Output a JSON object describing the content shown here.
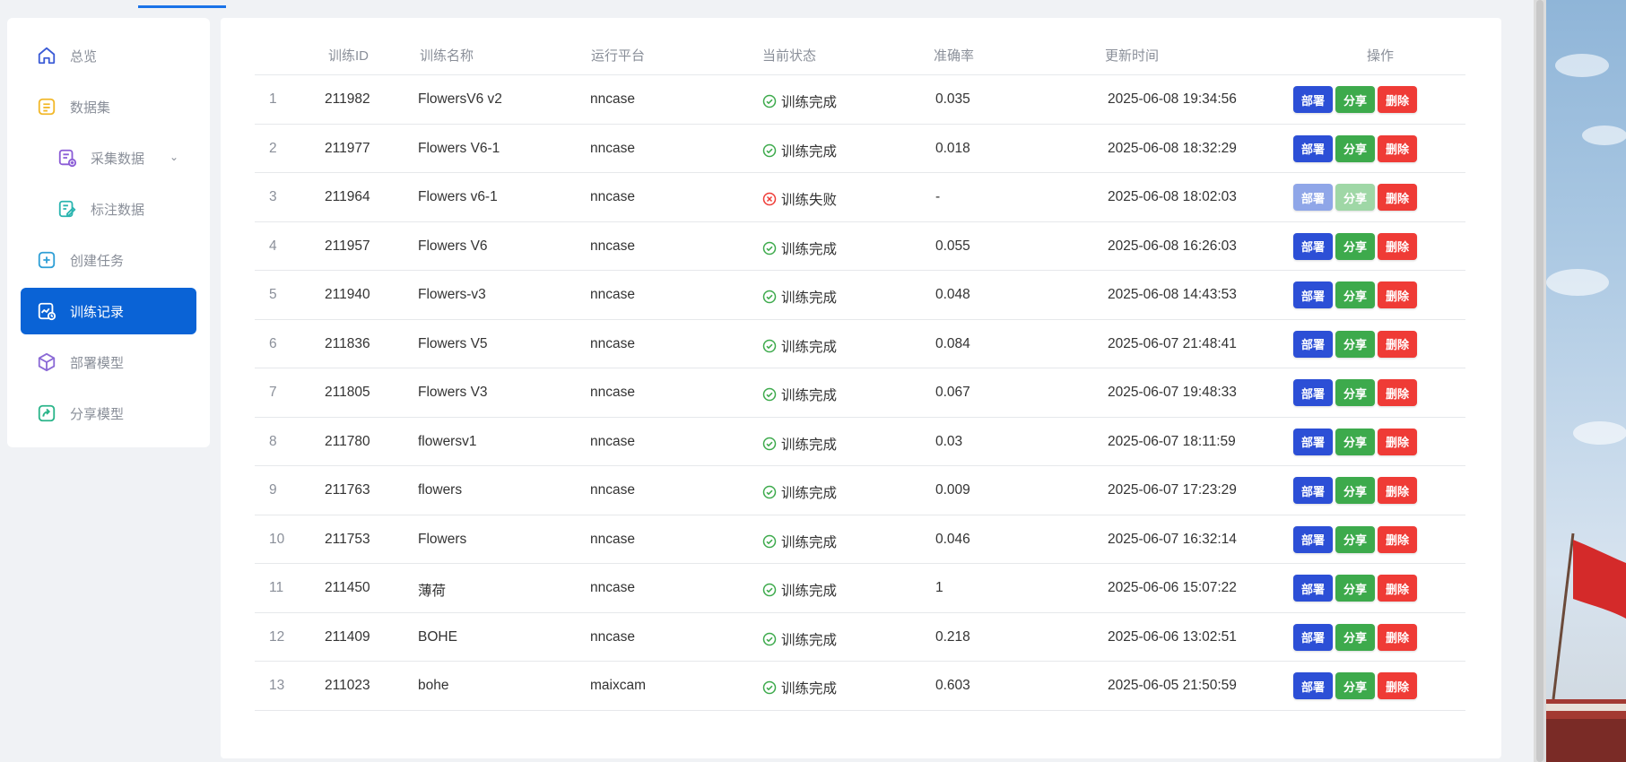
{
  "sidebar": {
    "items": [
      {
        "label": "总览",
        "icon": "home-icon"
      },
      {
        "label": "数据集",
        "icon": "dataset-icon"
      },
      {
        "label": "采集数据",
        "icon": "collect-data-icon"
      },
      {
        "label": "标注数据",
        "icon": "annotate-data-icon"
      },
      {
        "label": "创建任务",
        "icon": "plus-square-icon"
      },
      {
        "label": "训练记录",
        "icon": "training-record-icon"
      },
      {
        "label": "部署模型",
        "icon": "cube-icon"
      },
      {
        "label": "分享模型",
        "icon": "share-icon"
      }
    ],
    "active_index": 5,
    "chevron": "⌄"
  },
  "table": {
    "headers": {
      "id": "训练ID",
      "name": "训练名称",
      "platform": "运行平台",
      "status": "当前状态",
      "accuracy": "准确率",
      "updated": "更新时间",
      "actions": "操作"
    },
    "buttons": {
      "deploy": "部署",
      "share": "分享",
      "delete": "删除"
    },
    "rows": [
      {
        "no": "1",
        "id": "211982",
        "name": "FlowersV6 v2",
        "platform": "nncase",
        "status": "训练完成",
        "ok": true,
        "accuracy": "0.035",
        "updated": "2025-06-08 19:34:56"
      },
      {
        "no": "2",
        "id": "211977",
        "name": "Flowers V6-1",
        "platform": "nncase",
        "status": "训练完成",
        "ok": true,
        "accuracy": "0.018",
        "updated": "2025-06-08 18:32:29"
      },
      {
        "no": "3",
        "id": "211964",
        "name": "Flowers v6-1",
        "platform": "nncase",
        "status": "训练失败",
        "ok": false,
        "accuracy": "-",
        "updated": "2025-06-08 18:02:03"
      },
      {
        "no": "4",
        "id": "211957",
        "name": "Flowers V6",
        "platform": "nncase",
        "status": "训练完成",
        "ok": true,
        "accuracy": "0.055",
        "updated": "2025-06-08 16:26:03"
      },
      {
        "no": "5",
        "id": "211940",
        "name": "Flowers-v3",
        "platform": "nncase",
        "status": "训练完成",
        "ok": true,
        "accuracy": "0.048",
        "updated": "2025-06-08 14:43:53"
      },
      {
        "no": "6",
        "id": "211836",
        "name": "Flowers V5",
        "platform": "nncase",
        "status": "训练完成",
        "ok": true,
        "accuracy": "0.084",
        "updated": "2025-06-07 21:48:41"
      },
      {
        "no": "7",
        "id": "211805",
        "name": "Flowers V3",
        "platform": "nncase",
        "status": "训练完成",
        "ok": true,
        "accuracy": "0.067",
        "updated": "2025-06-07 19:48:33"
      },
      {
        "no": "8",
        "id": "211780",
        "name": "flowersv1",
        "platform": "nncase",
        "status": "训练完成",
        "ok": true,
        "accuracy": "0.03",
        "updated": "2025-06-07 18:11:59"
      },
      {
        "no": "9",
        "id": "211763",
        "name": "flowers",
        "platform": "nncase",
        "status": "训练完成",
        "ok": true,
        "accuracy": "0.009",
        "updated": "2025-06-07 17:23:29"
      },
      {
        "no": "10",
        "id": "211753",
        "name": "Flowers",
        "platform": "nncase",
        "status": "训练完成",
        "ok": true,
        "accuracy": "0.046",
        "updated": "2025-06-07 16:32:14"
      },
      {
        "no": "11",
        "id": "211450",
        "name": "薄荷",
        "platform": "nncase",
        "status": "训练完成",
        "ok": true,
        "accuracy": "1",
        "updated": "2025-06-06 15:07:22"
      },
      {
        "no": "12",
        "id": "211409",
        "name": "BOHE",
        "platform": "nncase",
        "status": "训练完成",
        "ok": true,
        "accuracy": "0.218",
        "updated": "2025-06-06 13:02:51"
      },
      {
        "no": "13",
        "id": "211023",
        "name": "bohe",
        "platform": "maixcam",
        "status": "训练完成",
        "ok": true,
        "accuracy": "0.603",
        "updated": "2025-06-05 21:50:59"
      }
    ]
  },
  "colors": {
    "accent": "#0a63d6",
    "deploy": "#2c4fd6",
    "share": "#3daa4c",
    "delete": "#ef3b36",
    "success": "#3daa4c",
    "fail": "#ef3b36"
  }
}
